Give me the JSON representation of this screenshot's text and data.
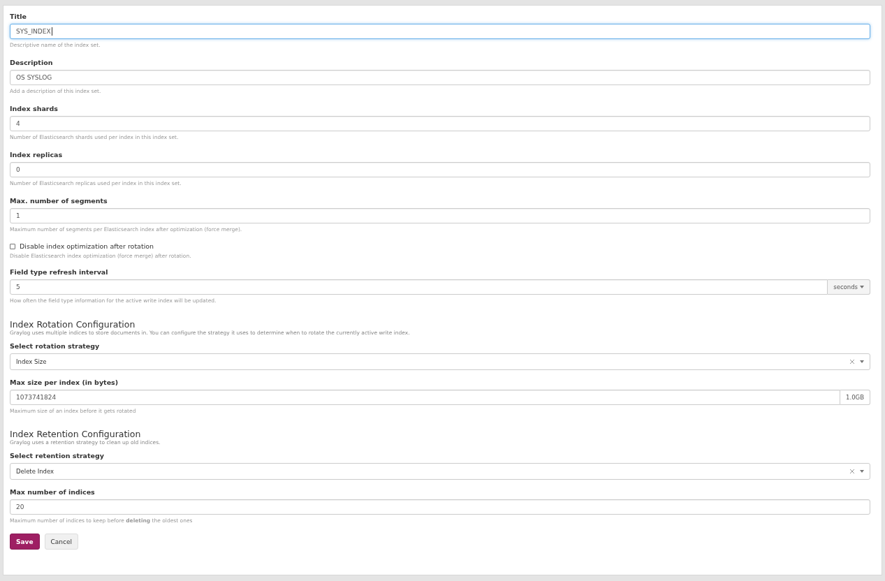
{
  "fields": [
    {
      "kind": "input",
      "label": "Title",
      "value": "SYS_INDEX",
      "focused": true,
      "help": "Descriptive name of the index set."
    },
    {
      "kind": "input",
      "label": "Description",
      "value": "OS SYSLOG",
      "focused": false,
      "help": "Add a description of this index set."
    },
    {
      "kind": "input",
      "label": "Index shards",
      "value": "4",
      "focused": false,
      "help": "Number of Elasticsearch shards used per index in this index set."
    },
    {
      "kind": "input",
      "label": "Index replicas",
      "value": "0",
      "focused": false,
      "help": "Number of Elasticsearch replicas used per index in this index set."
    },
    {
      "kind": "input",
      "label": "Max. number of segments",
      "value": "1",
      "focused": false,
      "help": "Maximum number of segments per Elasticsearch index after optimization (force merge)."
    },
    {
      "kind": "checkbox",
      "label": "Disable index optimization after rotation",
      "checked": false,
      "help": "Disable Elasticsearch index optimization (force merge) after rotation."
    },
    {
      "kind": "input_dropdown",
      "label": "Field type refresh interval",
      "value": "5",
      "addon": "seconds",
      "help": "How often the field type information for the active write index will be updated."
    },
    {
      "kind": "section",
      "title": "Index Rotation Configuration",
      "description": "Graylog uses multiple indices to store documents in. You can configure the strategy it uses to determine when to rotate the currently active write index."
    },
    {
      "kind": "select",
      "label": "Select rotation strategy",
      "value": "Index Size"
    },
    {
      "kind": "input_unit",
      "label": "Max size per index (in bytes)",
      "value": "1073741824",
      "addon": "1.0GB",
      "help": "Maximum size of an index before it gets rotated"
    },
    {
      "kind": "section",
      "title": "Index Retention Configuration",
      "description": "Graylog uses a retention strategy to clean up old indices."
    },
    {
      "kind": "select",
      "label": "Select retention strategy",
      "value": "Delete Index"
    },
    {
      "kind": "input",
      "label": "Max number of indices",
      "value": "20",
      "focused": false,
      "help": "Maximum number of indices to keep before **deleting** the oldest ones"
    }
  ],
  "buttons": [
    {
      "label": "Save",
      "kind": "primary"
    },
    {
      "label": "Cancel",
      "kind": "default"
    }
  ]
}
